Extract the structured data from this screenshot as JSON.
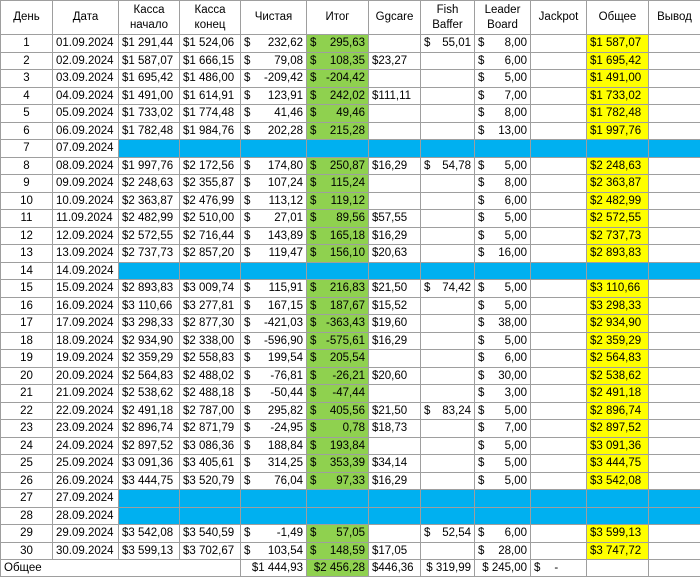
{
  "headers": [
    "День",
    "Дата",
    "Касса начало",
    "Касса конец",
    "Чистая",
    "Итог",
    "Ggcare",
    "Fish Baffer",
    "Leader Board",
    "Jackpot",
    "Общее",
    "Вывод"
  ],
  "rows": [
    {
      "day": "1",
      "date": "01.09.2024",
      "start": "$1 291,44",
      "end": "$1 524,06",
      "net": "232,62",
      "total": "295,63",
      "ggcare": "",
      "fish": "55,01",
      "lb": "8,00",
      "jackpot": "",
      "overall": "$1 587,07",
      "payout": ""
    },
    {
      "day": "2",
      "date": "02.09.2024",
      "start": "$1 587,07",
      "end": "$1 666,15",
      "net": "79,08",
      "total": "108,35",
      "ggcare": "$23,27",
      "fish": "",
      "lb": "6,00",
      "jackpot": "",
      "overall": "$1 695,42",
      "payout": ""
    },
    {
      "day": "3",
      "date": "03.09.2024",
      "start": "$1 695,42",
      "end": "$1 486,00",
      "net": "-209,42",
      "total": "-204,42",
      "ggcare": "",
      "fish": "",
      "lb": "5,00",
      "jackpot": "",
      "overall": "$1 491,00",
      "payout": ""
    },
    {
      "day": "4",
      "date": "04.09.2024",
      "start": "$1 491,00",
      "end": "$1 614,91",
      "net": "123,91",
      "total": "242,02",
      "ggcare": "$111,11",
      "fish": "",
      "lb": "7,00",
      "jackpot": "",
      "overall": "$1 733,02",
      "payout": ""
    },
    {
      "day": "5",
      "date": "05.09.2024",
      "start": "$1 733,02",
      "end": "$1 774,48",
      "net": "41,46",
      "total": "49,46",
      "ggcare": "",
      "fish": "",
      "lb": "8,00",
      "jackpot": "",
      "overall": "$1 782,48",
      "payout": ""
    },
    {
      "day": "6",
      "date": "06.09.2024",
      "start": "$1 782,48",
      "end": "$1 984,76",
      "net": "202,28",
      "total": "215,28",
      "ggcare": "",
      "fish": "",
      "lb": "13,00",
      "jackpot": "",
      "overall": "$1 997,76",
      "payout": ""
    },
    {
      "day": "7",
      "date": "07.09.2024",
      "off": true
    },
    {
      "day": "8",
      "date": "08.09.2024",
      "start": "$1 997,76",
      "end": "$2 172,56",
      "net": "174,80",
      "total": "250,87",
      "ggcare": "$16,29",
      "fish": "54,78",
      "lb": "5,00",
      "jackpot": "",
      "overall": "$2 248,63",
      "payout": ""
    },
    {
      "day": "9",
      "date": "09.09.2024",
      "start": "$2 248,63",
      "end": "$2 355,87",
      "net": "107,24",
      "total": "115,24",
      "ggcare": "",
      "fish": "",
      "lb": "8,00",
      "jackpot": "",
      "overall": "$2 363,87",
      "payout": ""
    },
    {
      "day": "10",
      "date": "10.09.2024",
      "start": "$2 363,87",
      "end": "$2 476,99",
      "net": "113,12",
      "total": "119,12",
      "ggcare": "",
      "fish": "",
      "lb": "6,00",
      "jackpot": "",
      "overall": "$2 482,99",
      "payout": ""
    },
    {
      "day": "11",
      "date": "11.09.2024",
      "start": "$2 482,99",
      "end": "$2 510,00",
      "net": "27,01",
      "total": "89,56",
      "ggcare": "$57,55",
      "fish": "",
      "lb": "5,00",
      "jackpot": "",
      "overall": "$2 572,55",
      "payout": ""
    },
    {
      "day": "12",
      "date": "12.09.2024",
      "start": "$2 572,55",
      "end": "$2 716,44",
      "net": "143,89",
      "total": "165,18",
      "ggcare": "$16,29",
      "fish": "",
      "lb": "5,00",
      "jackpot": "",
      "overall": "$2 737,73",
      "payout": ""
    },
    {
      "day": "13",
      "date": "13.09.2024",
      "start": "$2 737,73",
      "end": "$2 857,20",
      "net": "119,47",
      "total": "156,10",
      "ggcare": "$20,63",
      "fish": "",
      "lb": "16,00",
      "jackpot": "",
      "overall": "$2 893,83",
      "payout": ""
    },
    {
      "day": "14",
      "date": "14.09.2024",
      "off": true
    },
    {
      "day": "15",
      "date": "15.09.2024",
      "start": "$2 893,83",
      "end": "$3 009,74",
      "net": "115,91",
      "total": "216,83",
      "ggcare": "$21,50",
      "fish": "74,42",
      "lb": "5,00",
      "jackpot": "",
      "overall": "$3 110,66",
      "payout": ""
    },
    {
      "day": "16",
      "date": "16.09.2024",
      "start": "$3 110,66",
      "end": "$3 277,81",
      "net": "167,15",
      "total": "187,67",
      "ggcare": "$15,52",
      "fish": "",
      "lb": "5,00",
      "jackpot": "",
      "overall": "$3 298,33",
      "payout": ""
    },
    {
      "day": "17",
      "date": "17.09.2024",
      "start": "$3 298,33",
      "end": "$2 877,30",
      "net": "-421,03",
      "total": "-363,43",
      "ggcare": "$19,60",
      "fish": "",
      "lb": "38,00",
      "jackpot": "",
      "overall": "$2 934,90",
      "payout": ""
    },
    {
      "day": "18",
      "date": "18.09.2024",
      "start": "$2 934,90",
      "end": "$2 338,00",
      "net": "-596,90",
      "total": "-575,61",
      "ggcare": "$16,29",
      "fish": "",
      "lb": "5,00",
      "jackpot": "",
      "overall": "$2 359,29",
      "payout": ""
    },
    {
      "day": "19",
      "date": "19.09.2024",
      "start": "$2 359,29",
      "end": "$2 558,83",
      "net": "199,54",
      "total": "205,54",
      "ggcare": "",
      "fish": "",
      "lb": "6,00",
      "jackpot": "",
      "overall": "$2 564,83",
      "payout": ""
    },
    {
      "day": "20",
      "date": "20.09.2024",
      "start": "$2 564,83",
      "end": "$2 488,02",
      "net": "-76,81",
      "total": "-26,21",
      "ggcare": "$20,60",
      "fish": "",
      "lb": "30,00",
      "jackpot": "",
      "overall": "$2 538,62",
      "payout": ""
    },
    {
      "day": "21",
      "date": "21.09.2024",
      "start": "$2 538,62",
      "end": "$2 488,18",
      "net": "-50,44",
      "total": "-47,44",
      "ggcare": "",
      "fish": "",
      "lb": "3,00",
      "jackpot": "",
      "overall": "$2 491,18",
      "payout": ""
    },
    {
      "day": "22",
      "date": "22.09.2024",
      "start": "$2 491,18",
      "end": "$2 787,00",
      "net": "295,82",
      "total": "405,56",
      "ggcare": "$21,50",
      "fish": "83,24",
      "lb": "5,00",
      "jackpot": "",
      "overall": "$2 896,74",
      "payout": ""
    },
    {
      "day": "23",
      "date": "23.09.2024",
      "start": "$2 896,74",
      "end": "$2 871,79",
      "net": "-24,95",
      "total": "0,78",
      "ggcare": "$18,73",
      "fish": "",
      "lb": "7,00",
      "jackpot": "",
      "overall": "$2 897,52",
      "payout": ""
    },
    {
      "day": "24",
      "date": "24.09.2024",
      "start": "$2 897,52",
      "end": "$3 086,36",
      "net": "188,84",
      "total": "193,84",
      "ggcare": "",
      "fish": "",
      "lb": "5,00",
      "jackpot": "",
      "overall": "$3 091,36",
      "payout": ""
    },
    {
      "day": "25",
      "date": "25.09.2024",
      "start": "$3 091,36",
      "end": "$3 405,61",
      "net": "314,25",
      "total": "353,39",
      "ggcare": "$34,14",
      "fish": "",
      "lb": "5,00",
      "jackpot": "",
      "overall": "$3 444,75",
      "payout": ""
    },
    {
      "day": "26",
      "date": "26.09.2024",
      "start": "$3 444,75",
      "end": "$3 520,79",
      "net": "76,04",
      "total": "97,33",
      "ggcare": "$16,29",
      "fish": "",
      "lb": "5,00",
      "jackpot": "",
      "overall": "$3 542,08",
      "payout": ""
    },
    {
      "day": "27",
      "date": "27.09.2024",
      "off": true
    },
    {
      "day": "28",
      "date": "28.09.2024",
      "off": true
    },
    {
      "day": "29",
      "date": "29.09.2024",
      "start": "$3 542,08",
      "end": "$3 540,59",
      "net": "-1,49",
      "total": "57,05",
      "ggcare": "",
      "fish": "52,54",
      "lb": "6,00",
      "jackpot": "",
      "overall": "$3 599,13",
      "payout": ""
    },
    {
      "day": "30",
      "date": "30.09.2024",
      "start": "$3 599,13",
      "end": "$3 702,67",
      "net": "103,54",
      "total": "148,59",
      "ggcare": "$17,05",
      "fish": "",
      "lb": "28,00",
      "jackpot": "",
      "overall": "$3 747,72",
      "payout": ""
    }
  ],
  "totals": {
    "label": "Общее",
    "net": "$1 444,93",
    "total": "$2 456,28",
    "ggcare": "$446,36",
    "fish": "$ 319,99",
    "lb": "$ 245,00",
    "jackpot_cur": "$",
    "jackpot_val": "-"
  },
  "currency": "$",
  "colors": {
    "total_col": "#8fd14f",
    "overall_col": "#ffff00",
    "off_row": "#00b0f0"
  }
}
